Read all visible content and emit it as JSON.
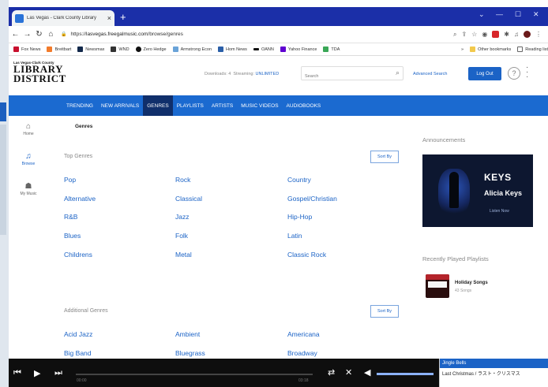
{
  "browser": {
    "tab_title": "Las Vegas - Clark County Library",
    "url_host": "lasvegas.freegalmusic.com",
    "url_prefix": "https://",
    "url_path": "/browse/genres",
    "bookmarks": [
      "Fox News",
      "Breitbart",
      "Newsmax",
      "WND",
      "Zero Hedge",
      "Armstrong Econ",
      "Hom News",
      "OANN",
      "Yahoo Finance",
      "TDA"
    ],
    "other_bookmarks": "Other bookmarks",
    "reading_list": "Reading list",
    "colors": {
      "tabbar": "#1b2fa8"
    }
  },
  "site": {
    "logo_small": "Las Vegas-Clark County",
    "logo_line1": "LIBRARY",
    "logo_line2": "DISTRICT",
    "downloads_label": "Downloads: 4",
    "streaming_label": "Streaming:",
    "streaming_value": "UNLIMITED",
    "search_placeholder": "Search",
    "advanced_search": "Advanced Search",
    "login": "Log Out",
    "help": "?",
    "accent": "#1b63c6"
  },
  "nav": {
    "items": [
      "TRENDING",
      "NEW ARRIVALS",
      "GENRES",
      "PLAYLISTS",
      "ARTISTS",
      "MUSIC VIDEOS",
      "AUDIOBOOKS"
    ],
    "active": "GENRES"
  },
  "rail": {
    "home": "Home",
    "browse": "Browse",
    "my_music": "My Music"
  },
  "content": {
    "breadcrumb": "Genres",
    "top_genres_title": "Top Genres",
    "sort_by": "Sort By",
    "top_genres": [
      [
        "Pop",
        "Rock",
        "Country"
      ],
      [
        "Alternative",
        "Classical",
        "Gospel/Christian"
      ],
      [
        "R&B",
        "Jazz",
        "Hip-Hop"
      ],
      [
        "Blues",
        "Folk",
        "Latin"
      ],
      [
        "Childrens",
        "Metal",
        "Classic Rock"
      ]
    ],
    "additional_genres_title": "Additional Genres",
    "additional_genres": [
      [
        "Acid Jazz",
        "Ambient",
        "Americana"
      ],
      [
        "Big Band",
        "Bluegrass",
        "Broadway"
      ]
    ]
  },
  "sidebar": {
    "announcements": "Announcements",
    "promo_title": "KEYS",
    "promo_artist": "Alicia Keys",
    "promo_cta": "Listen Now",
    "recently_played": "Recently Played Playlists",
    "playlist_name": "Holiday Songs",
    "playlist_count": "43 Songs"
  },
  "player": {
    "time_elapsed": "00:00",
    "time_total": "03:18",
    "queue": [
      "Jingle Bells",
      "Last Christmas / ラスト・クリスマス"
    ]
  }
}
